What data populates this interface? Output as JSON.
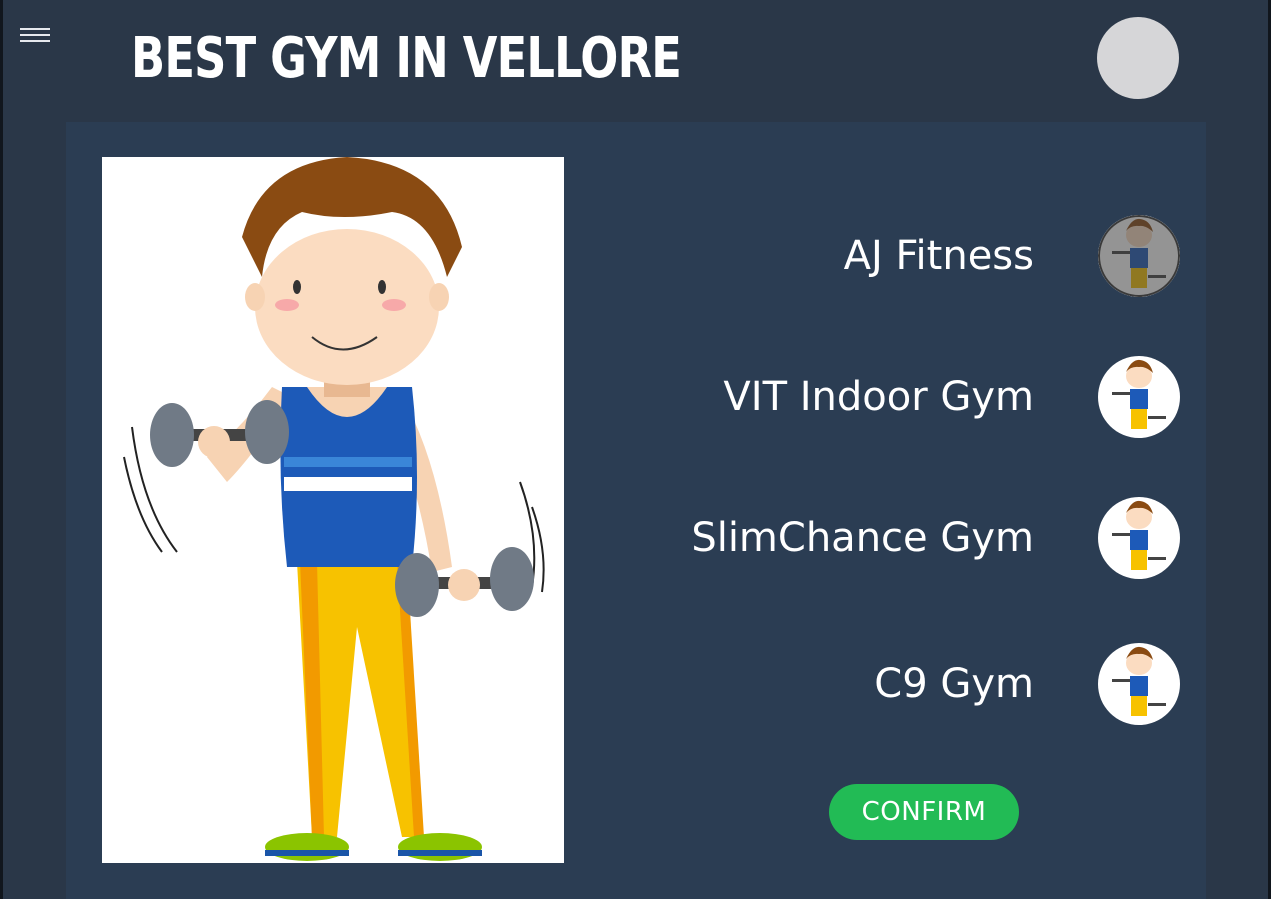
{
  "header": {
    "title": "BEST GYM IN VELLORE",
    "menu_icon": "hamburger-menu-icon",
    "avatar_icon": "user-avatar"
  },
  "hero": {
    "illustration": "cartoon-boy-lifting-dumbbells"
  },
  "gyms": [
    {
      "name": "AJ Fitness",
      "selected": true
    },
    {
      "name": "VIT Indoor Gym",
      "selected": false
    },
    {
      "name": "SlimChance Gym",
      "selected": false
    },
    {
      "name": "C9 Gym",
      "selected": false
    }
  ],
  "actions": {
    "confirm_label": "CONFIRM"
  },
  "colors": {
    "background": "#2a3748",
    "panel": "#2b3d53",
    "confirm": "#22bb55",
    "avatar": "#d6d6d8"
  }
}
